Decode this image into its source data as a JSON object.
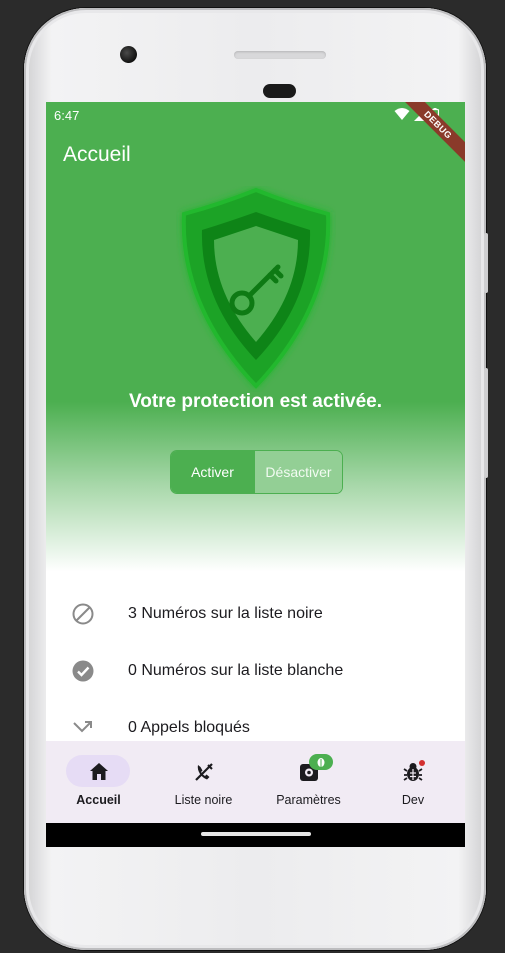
{
  "status_bar": {
    "time": "6:47",
    "debug_label": "DEBUG"
  },
  "app_bar": {
    "title": "Accueil"
  },
  "hero": {
    "message": "Votre protection est activée.",
    "toggle": {
      "activate_label": "Activer",
      "deactivate_label": "Désactiver",
      "selected": "Activer"
    }
  },
  "stats": [
    {
      "icon": "block-icon",
      "label": "3 Numéros sur la liste noire"
    },
    {
      "icon": "check-circle-icon",
      "label": "0 Numéros sur la liste blanche"
    },
    {
      "icon": "call-missed-icon",
      "label": "0 Appels bloqués"
    }
  ],
  "bottom_nav": [
    {
      "icon": "home-icon",
      "label": "Accueil",
      "active": true
    },
    {
      "icon": "phone-disabled-icon",
      "label": "Liste noire",
      "active": false
    },
    {
      "icon": "settings-icon",
      "label": "Paramètres",
      "active": false
    },
    {
      "icon": "bug-icon",
      "label": "Dev",
      "active": false
    }
  ],
  "colors": {
    "primary": "#4caf50",
    "nav_background": "#f1ebf4",
    "nav_indicator": "#e6dcf5"
  }
}
